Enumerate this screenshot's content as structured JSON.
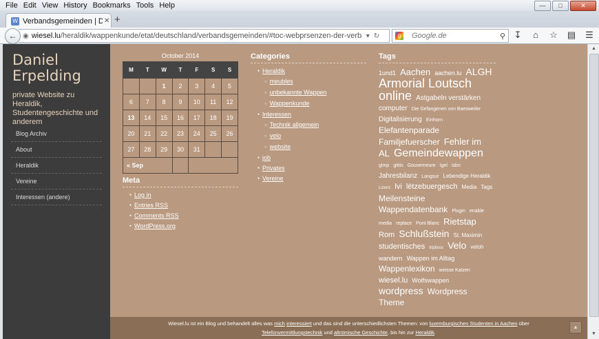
{
  "menu": [
    "File",
    "Edit",
    "View",
    "History",
    "Bookmarks",
    "Tools",
    "Help"
  ],
  "window_buttons": {
    "minimize": "—",
    "maximize": "□",
    "close": "✕"
  },
  "tab": {
    "title": "Verbandsgemeinden | Daniel Er...",
    "close": "✕"
  },
  "new_tab": "+",
  "url": {
    "host": "wiesel.lu",
    "path": "/heraldik/wappenkunde/etat/deutschland/verbandsgemeinden/#toc-webprsenzen-der-verbandsgemeinden"
  },
  "search": {
    "engine_icon": "google-icon",
    "placeholder": "Google.de"
  },
  "site": {
    "title": "Daniel Erpelding",
    "description": "private Website zu Heraldik, Studentengeschichte und anderem"
  },
  "sidebar_nav": [
    "Blog Archiv",
    "About",
    "Heraldik",
    "Vereine",
    "Interessen (andere)"
  ],
  "calendar": {
    "caption": "October 2014",
    "weekdays": [
      "M",
      "T",
      "W",
      "T",
      "F",
      "S",
      "S"
    ],
    "weeks": [
      [
        "",
        "",
        "1",
        "2",
        "3",
        "4",
        "5"
      ],
      [
        "6",
        "7",
        "8",
        "9",
        "10",
        "11",
        "12"
      ],
      [
        "13",
        "14",
        "15",
        "16",
        "17",
        "18",
        "19"
      ],
      [
        "20",
        "21",
        "22",
        "23",
        "24",
        "25",
        "26"
      ],
      [
        "27",
        "28",
        "29",
        "30",
        "31",
        "",
        ""
      ]
    ],
    "prev": "« Sep"
  },
  "meta": {
    "title": "Meta",
    "links": [
      "Log in",
      "Entries RSS",
      "Comments RSS",
      "WordPress.org"
    ]
  },
  "categories": {
    "title": "Categories",
    "items": [
      {
        "label": "Heraldik",
        "level": 1
      },
      {
        "label": "meubles",
        "level": 2
      },
      {
        "label": "unbekannte Wappen",
        "level": 2
      },
      {
        "label": "Wappenkunde",
        "level": 2
      },
      {
        "label": "Interessen",
        "level": 1
      },
      {
        "label": "Technik allgemein",
        "level": 2
      },
      {
        "label": "velo",
        "level": 2
      },
      {
        "label": "website",
        "level": 2
      },
      {
        "label": "job",
        "level": 1
      },
      {
        "label": "Privates",
        "level": 1
      },
      {
        "label": "Vereine",
        "level": 1
      }
    ]
  },
  "tags": {
    "title": "Tags",
    "cloud": [
      {
        "t": "1und1",
        "s": 9
      },
      {
        "t": "Aachen",
        "s": 13
      },
      {
        "t": "aachen.lu",
        "s": 9
      },
      {
        "t": "ALGH",
        "s": 14
      },
      {
        "t": "Armorial Loutsch online",
        "s": 18
      },
      {
        "t": "Astgabeln verstärken",
        "s": 10
      },
      {
        "t": "computer",
        "s": 10
      },
      {
        "t": "Die Gefangenen von Baesweiler",
        "s": 7
      },
      {
        "t": "Digitalisierung",
        "s": 10
      },
      {
        "t": "Einhorn",
        "s": 7
      },
      {
        "t": "Elefantenparade",
        "s": 12
      },
      {
        "t": "Familjefuerscher",
        "s": 12
      },
      {
        "t": "Fehler im AL",
        "s": 13
      },
      {
        "t": "Gemeindewappen",
        "s": 16
      },
      {
        "t": "gimp",
        "s": 7
      },
      {
        "t": "gittis",
        "s": 7
      },
      {
        "t": "Gouverneure",
        "s": 7
      },
      {
        "t": "Igel",
        "s": 7
      },
      {
        "t": "isbn",
        "s": 7
      },
      {
        "t": "Jahresbilanz",
        "s": 10
      },
      {
        "t": "Langsur",
        "s": 7
      },
      {
        "t": "Lebendige Heraldik",
        "s": 8
      },
      {
        "t": "Lizenz",
        "s": 6
      },
      {
        "t": "lvi",
        "s": 11
      },
      {
        "t": "lëtzebuergesch",
        "s": 11
      },
      {
        "t": "Media",
        "s": 8
      },
      {
        "t": "Tags",
        "s": 8
      },
      {
        "t": "Meilensteine",
        "s": 12
      },
      {
        "t": "Wappendatenbank",
        "s": 12
      },
      {
        "t": "Plugin",
        "s": 7
      },
      {
        "t": "enable",
        "s": 7
      },
      {
        "t": "media",
        "s": 7
      },
      {
        "t": "replace",
        "s": 7
      },
      {
        "t": "Pont Blanc",
        "s": 7
      },
      {
        "t": "Rietstap",
        "s": 13
      },
      {
        "t": "Rom",
        "s": 11
      },
      {
        "t": "Schlußstein",
        "s": 14
      },
      {
        "t": "St. Maximin",
        "s": 8
      },
      {
        "t": "studentisches",
        "s": 11
      },
      {
        "t": "triptisos",
        "s": 6
      },
      {
        "t": "Velo",
        "s": 14
      },
      {
        "t": "veloh",
        "s": 8
      },
      {
        "t": "wandern",
        "s": 9
      },
      {
        "t": "Wappen im Alltag",
        "s": 9
      },
      {
        "t": "Wappenlexikon",
        "s": 12
      },
      {
        "t": "weisse Katzen",
        "s": 7
      },
      {
        "t": "wiesel.lu",
        "s": 11
      },
      {
        "t": "Wolfswappen",
        "s": 9
      },
      {
        "t": "wordpress",
        "s": 14
      },
      {
        "t": "Wordpress Theme",
        "s": 12
      }
    ]
  },
  "footer": {
    "p1": "Wiesel.lu ist ein Blog und behandelt alles was ",
    "l1": "mich",
    "l2": "interessiert",
    "p2": " und das sind die unterschiedlichsten Themen: von ",
    "l3": "luxemburgischen Studenten in Aachen",
    "p3": " über",
    "l4": "Telefonvermittlungstechnik",
    "p4": " und ",
    "l5": "altrömische Geschichte",
    "p5": ", bis hin zur ",
    "l6": "Heraldik",
    "p6": "."
  }
}
